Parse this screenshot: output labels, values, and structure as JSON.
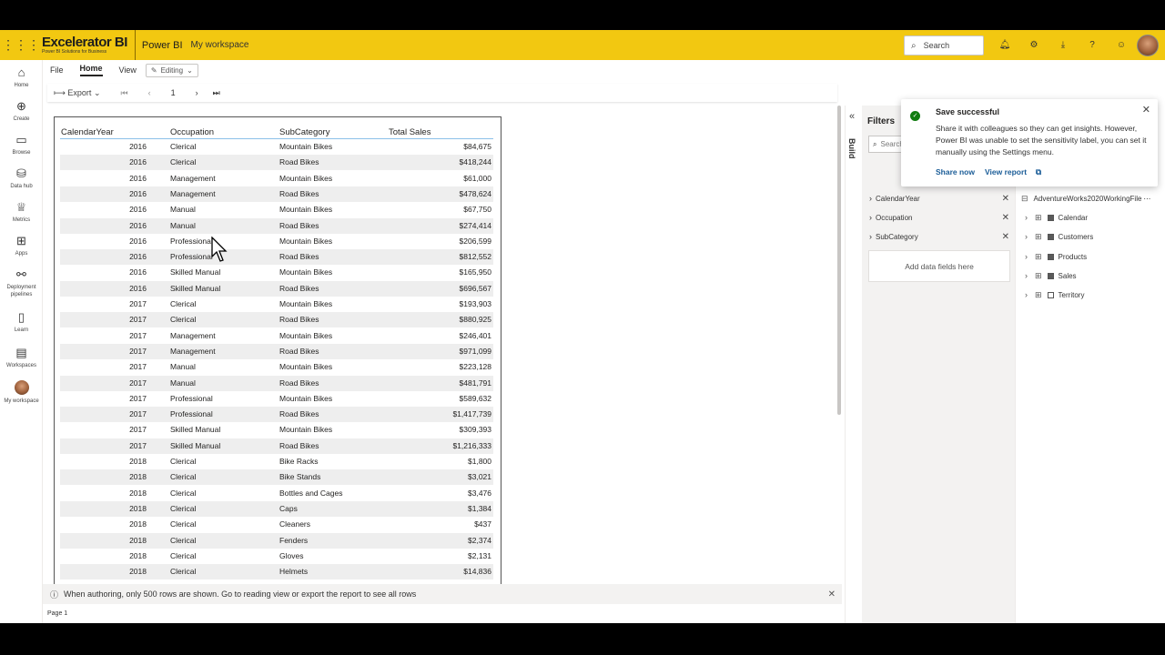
{
  "topbar": {
    "logo_main": "Excelerator BI",
    "logo_sub": "Power BI Solutions for Business",
    "app_name": "Power BI",
    "workspace": "My workspace",
    "search_placeholder": "Search",
    "icons": [
      "bell-icon",
      "gear-icon",
      "download-icon",
      "help-icon",
      "smiley-icon"
    ]
  },
  "leftnav": [
    {
      "label": "Home",
      "icon": "home-icon"
    },
    {
      "label": "Create",
      "icon": "create-icon"
    },
    {
      "label": "Browse",
      "icon": "folder-icon"
    },
    {
      "label": "Data hub",
      "icon": "data-hub-icon"
    },
    {
      "label": "Metrics",
      "icon": "trophy-icon"
    },
    {
      "label": "Apps",
      "icon": "apps-icon"
    },
    {
      "label": "Deployment pipelines",
      "icon": "pipelines-icon"
    },
    {
      "label": "Learn",
      "icon": "book-icon"
    },
    {
      "label": "Workspaces",
      "icon": "workspaces-icon"
    },
    {
      "label": "My workspace",
      "icon": "avatar"
    }
  ],
  "menu": {
    "file": "File",
    "home": "Home",
    "view": "View",
    "editing": "Editing"
  },
  "toolbar": {
    "export": "Export",
    "page_number": "1"
  },
  "table": {
    "headers": [
      "CalendarYear",
      "Occupation",
      "SubCategory",
      "Total Sales"
    ],
    "rows": [
      [
        "2016",
        "Clerical",
        "Mountain Bikes",
        "$84,675"
      ],
      [
        "2016",
        "Clerical",
        "Road Bikes",
        "$418,244"
      ],
      [
        "2016",
        "Management",
        "Mountain Bikes",
        "$61,000"
      ],
      [
        "2016",
        "Management",
        "Road Bikes",
        "$478,624"
      ],
      [
        "2016",
        "Manual",
        "Mountain Bikes",
        "$67,750"
      ],
      [
        "2016",
        "Manual",
        "Road Bikes",
        "$274,414"
      ],
      [
        "2016",
        "Professional",
        "Mountain Bikes",
        "$206,599"
      ],
      [
        "2016",
        "Professional",
        "Road Bikes",
        "$812,552"
      ],
      [
        "2016",
        "Skilled Manual",
        "Mountain Bikes",
        "$165,950"
      ],
      [
        "2016",
        "Skilled Manual",
        "Road Bikes",
        "$696,567"
      ],
      [
        "2017",
        "Clerical",
        "Mountain Bikes",
        "$193,903"
      ],
      [
        "2017",
        "Clerical",
        "Road Bikes",
        "$880,925"
      ],
      [
        "2017",
        "Management",
        "Mountain Bikes",
        "$246,401"
      ],
      [
        "2017",
        "Management",
        "Road Bikes",
        "$971,099"
      ],
      [
        "2017",
        "Manual",
        "Mountain Bikes",
        "$223,128"
      ],
      [
        "2017",
        "Manual",
        "Road Bikes",
        "$481,791"
      ],
      [
        "2017",
        "Professional",
        "Mountain Bikes",
        "$589,632"
      ],
      [
        "2017",
        "Professional",
        "Road Bikes",
        "$1,417,739"
      ],
      [
        "2017",
        "Skilled Manual",
        "Mountain Bikes",
        "$309,393"
      ],
      [
        "2017",
        "Skilled Manual",
        "Road Bikes",
        "$1,216,333"
      ],
      [
        "2018",
        "Clerical",
        "Bike Racks",
        "$1,800"
      ],
      [
        "2018",
        "Clerical",
        "Bike Stands",
        "$3,021"
      ],
      [
        "2018",
        "Clerical",
        "Bottles and Cages",
        "$3,476"
      ],
      [
        "2018",
        "Clerical",
        "Caps",
        "$1,384"
      ],
      [
        "2018",
        "Clerical",
        "Cleaners",
        "$437"
      ],
      [
        "2018",
        "Clerical",
        "Fenders",
        "$2,374"
      ],
      [
        "2018",
        "Clerical",
        "Gloves",
        "$2,131"
      ],
      [
        "2018",
        "Clerical",
        "Helmets",
        "$14,836"
      ]
    ]
  },
  "info_bar": "When authoring, only 500 rows are shown. Go to reading view or export the report to see all rows",
  "page_tab": "Page 1",
  "side": {
    "build_label": "Build"
  },
  "filters": {
    "title": "Filters",
    "search_placeholder": "Search",
    "items": [
      "CalendarYear",
      "Occupation",
      "SubCategory"
    ],
    "drop_hint": "Add data fields here"
  },
  "data_pane": {
    "model": "AdventureWorks2020WorkingFile",
    "tables": [
      {
        "name": "Calendar",
        "checked": true
      },
      {
        "name": "Customers",
        "checked": true
      },
      {
        "name": "Products",
        "checked": true
      },
      {
        "name": "Sales",
        "checked": true
      },
      {
        "name": "Territory",
        "checked": false
      }
    ]
  },
  "toast": {
    "title": "Save successful",
    "body": "Share it with colleagues so they can get insights. However, Power BI was unable to set the sensitivity label, you can set it manually using the Settings menu.",
    "action1": "Share now",
    "action2": "View report"
  },
  "colors": {
    "brand_yellow": "#f2c811",
    "success_green": "#107c10",
    "link_blue": "#1a5c97"
  }
}
